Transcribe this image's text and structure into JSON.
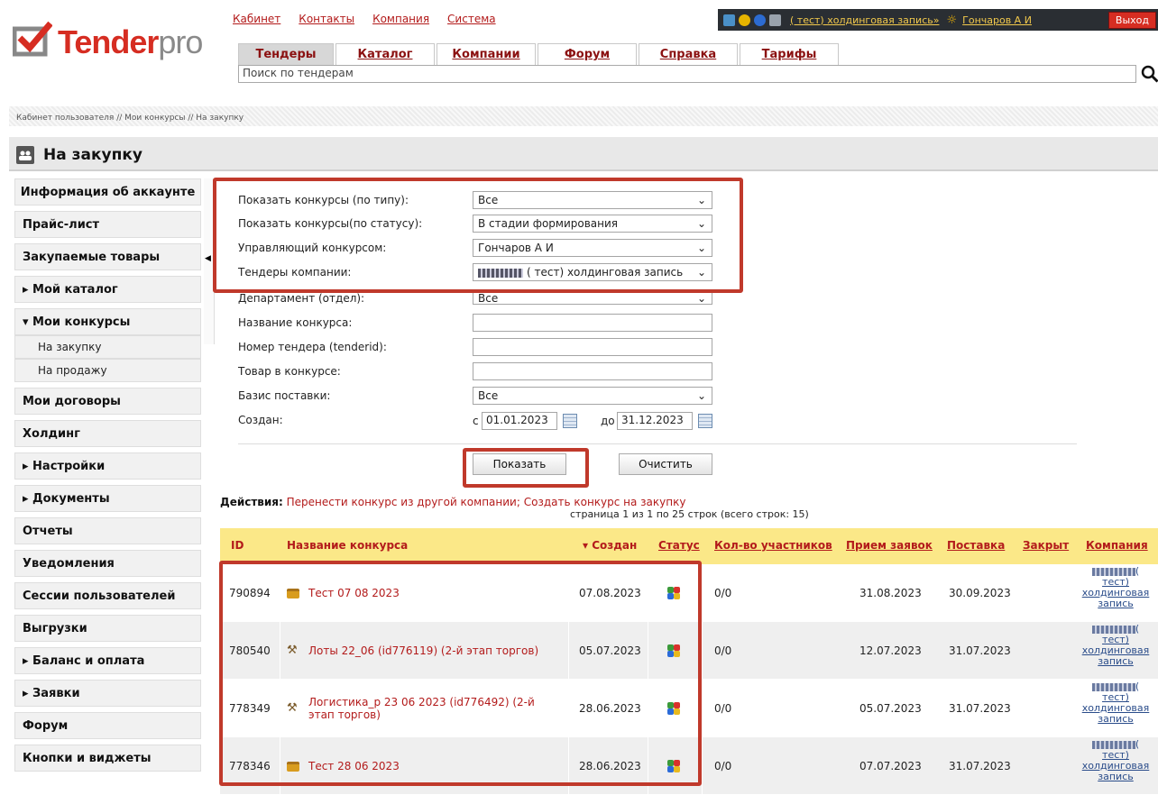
{
  "brand": {
    "name_bold": "Tender",
    "name_thin": "pro",
    "accent": "#d62d22"
  },
  "top_links": [
    "Кабинет",
    "Контакты",
    "Компания",
    "Система"
  ],
  "userbar": {
    "company": "( тест) холдинговая запись»",
    "user": "Гончаров А И",
    "exit": "Выход"
  },
  "tabs": [
    {
      "label": "Тендеры",
      "active": true
    },
    {
      "label": "Каталог"
    },
    {
      "label": "Компании"
    },
    {
      "label": "Форум"
    },
    {
      "label": "Справка"
    },
    {
      "label": "Тарифы"
    }
  ],
  "search": {
    "placeholder": "Поиск по тендерам"
  },
  "breadcrumb": {
    "link": "Кабинет пользователя",
    "rest": " // Мои конкурсы // На закупку"
  },
  "page_title": "На закупку",
  "sidebar": {
    "items": [
      "Информация об аккаунте",
      "Прайс-лист",
      "Закупаемые товары",
      "▸ Мой каталог",
      "▾ Мои конкурсы",
      "Мои договоры",
      "Холдинг",
      "▸ Настройки",
      "▸ Документы",
      "Отчеты",
      "Уведомления",
      "Сессии пользователей",
      "Выгрузки",
      "▸ Баланс и оплата",
      "▸ Заявки",
      "Форум",
      "Кнопки и виджеты"
    ],
    "sub_items": [
      "На закупку",
      "На продажу"
    ]
  },
  "filter": {
    "type_label": "Показать конкурсы (по типу):",
    "type_value": "Все",
    "status_label": "Показать конкурсы(по статусу):",
    "status_value": "В стадии формирования",
    "manager_label": "Управляющий конкурсом:",
    "manager_value": "Гончаров А И",
    "company_label": "Тендеры компании:",
    "company_value": "( тест) холдинговая запись",
    "dept_label": "Департамент (отдел):",
    "dept_value": "Все",
    "name_label": "Название конкурса:",
    "number_label": "Номер тендера (tenderid):",
    "goods_label": "Товар в конкурсе:",
    "basis_label": "Базис поставки:",
    "basis_value": "Все",
    "created_label": "Создан:",
    "from_prefix": "с",
    "from_value": "01.01.2023",
    "to_prefix": "до",
    "to_value": "31.12.2023",
    "show_button": "Показать",
    "clear_button": "Очистить"
  },
  "actions": {
    "label": "Действия:",
    "link1": "Перенести конкурс из другой компании;",
    "link2": "Создать конкурс на закупку"
  },
  "pager": "страница 1 из 1 по 25 строк (всего строк: 15)",
  "table": {
    "headers": [
      "ID",
      "Название конкурса",
      "▾ Создан",
      "Статус",
      "Кол-во участников",
      "Прием заявок",
      "Поставка",
      "Закрыт",
      "Компания"
    ],
    "rows": [
      {
        "id": "790894",
        "name": "Тест 07 08 2023",
        "created": "07.08.2023",
        "participants": "0/0",
        "accept": "31.08.2023",
        "delivery": "30.09.2023",
        "icon": "briefcase-icon"
      },
      {
        "id": "780540",
        "name": "Лоты 22_06 (id776119) (2-й этап торгов)",
        "created": "05.07.2023",
        "participants": "0/0",
        "accept": "12.07.2023",
        "delivery": "31.07.2023",
        "icon": "gavel-icon"
      },
      {
        "id": "778349",
        "name": "Логистика_р 23 06 2023 (id776492) (2-й этап торгов)",
        "created": "28.06.2023",
        "participants": "0/0",
        "accept": "05.07.2023",
        "delivery": "31.07.2023",
        "icon": "gavel-icon"
      },
      {
        "id": "778346",
        "name": "Тест 28 06 2023",
        "created": "28.06.2023",
        "participants": "0/0",
        "accept": "07.07.2023",
        "delivery": "31.07.2023",
        "icon": "briefcase-icon"
      }
    ],
    "company_cell": {
      "open": "(",
      "line1": "тест)",
      "line2": "холдинговая",
      "line3": "запись"
    }
  }
}
